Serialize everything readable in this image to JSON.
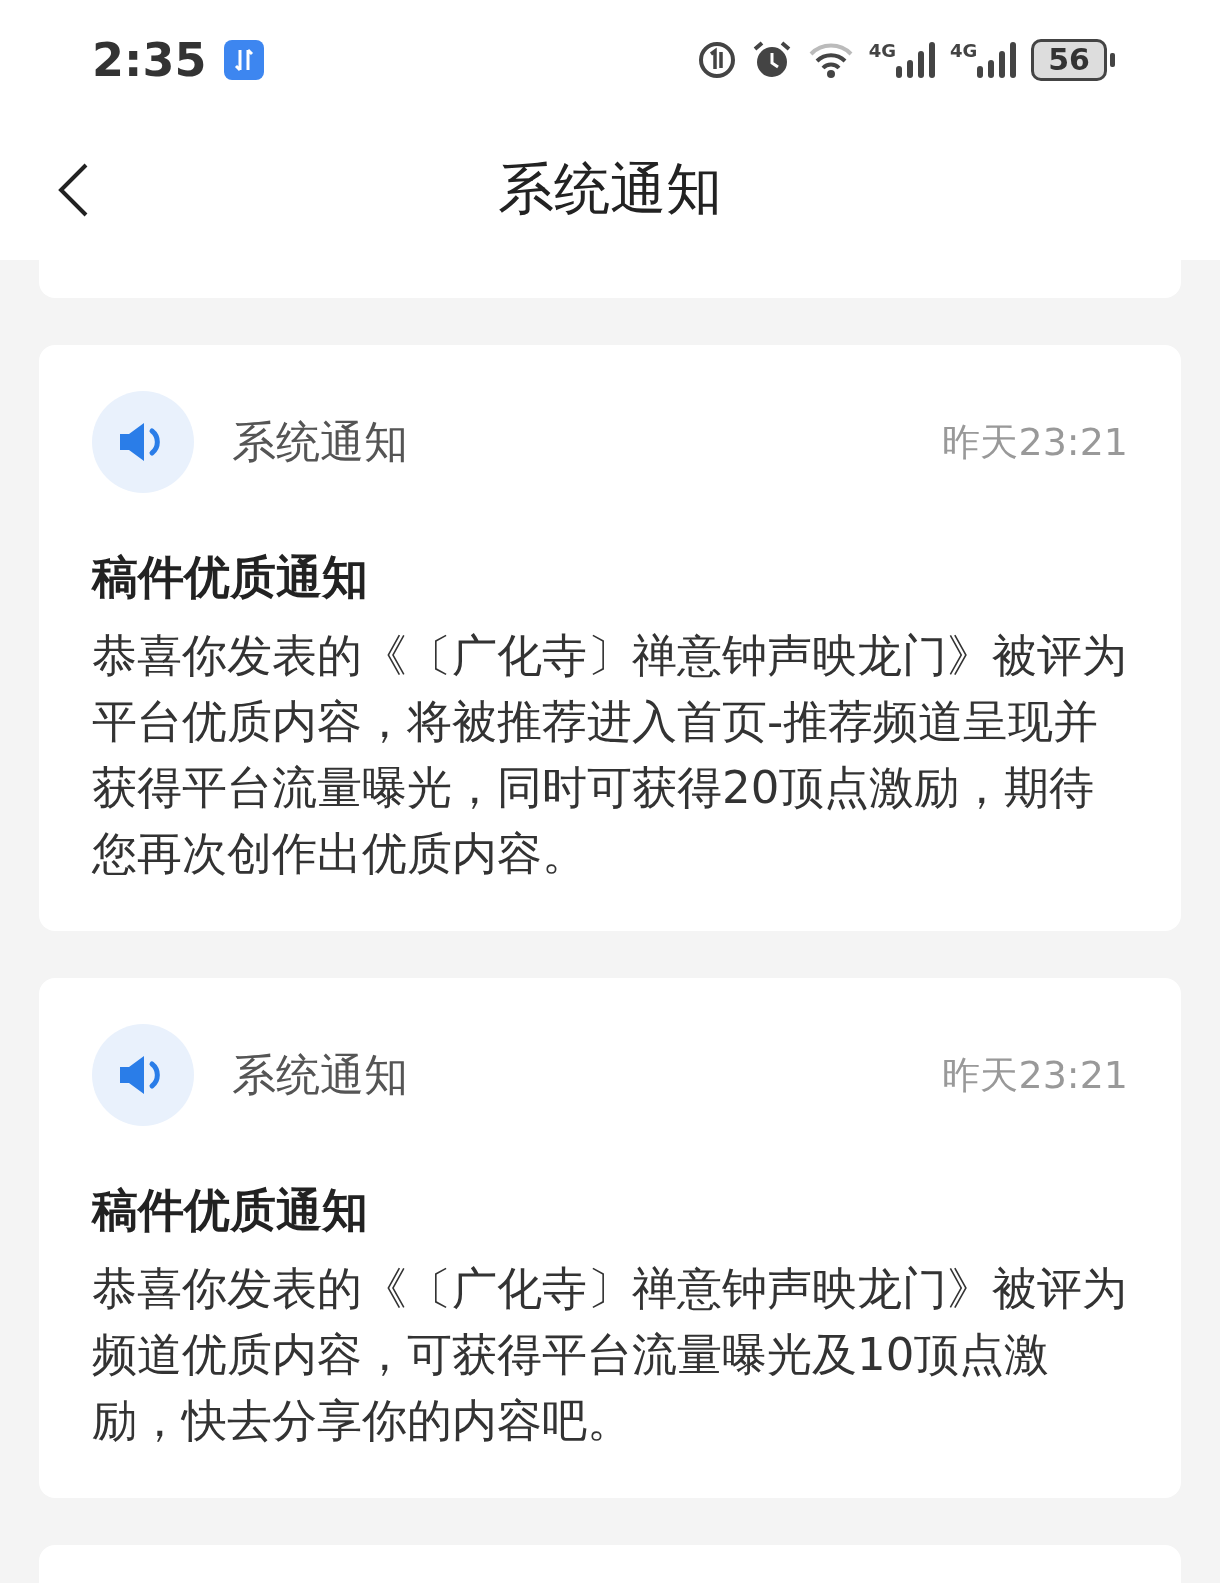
{
  "status_bar": {
    "time": "2:35",
    "signals": [
      {
        "label": "4G"
      },
      {
        "label": "4G"
      }
    ],
    "battery": "56"
  },
  "header": {
    "title": "系统通知"
  },
  "notifications": [
    {
      "source": "系统通知",
      "time": "昨天23:21",
      "title": "稿件优质通知",
      "body": "恭喜你发表的《〔广化寺〕禅意钟声映龙门》被评为平台优质内容，将被推荐进入首页-推荐频道呈现并获得平台流量曝光，同时可获得20顶点激励，期待您再次创作出优质内容。"
    },
    {
      "source": "系统通知",
      "time": "昨天23:21",
      "title": "稿件优质通知",
      "body": "恭喜你发表的《〔广化寺〕禅意钟声映龙门》被评为频道优质内容，可获得平台流量曝光及10顶点激励，快去分享你的内容吧。"
    }
  ]
}
